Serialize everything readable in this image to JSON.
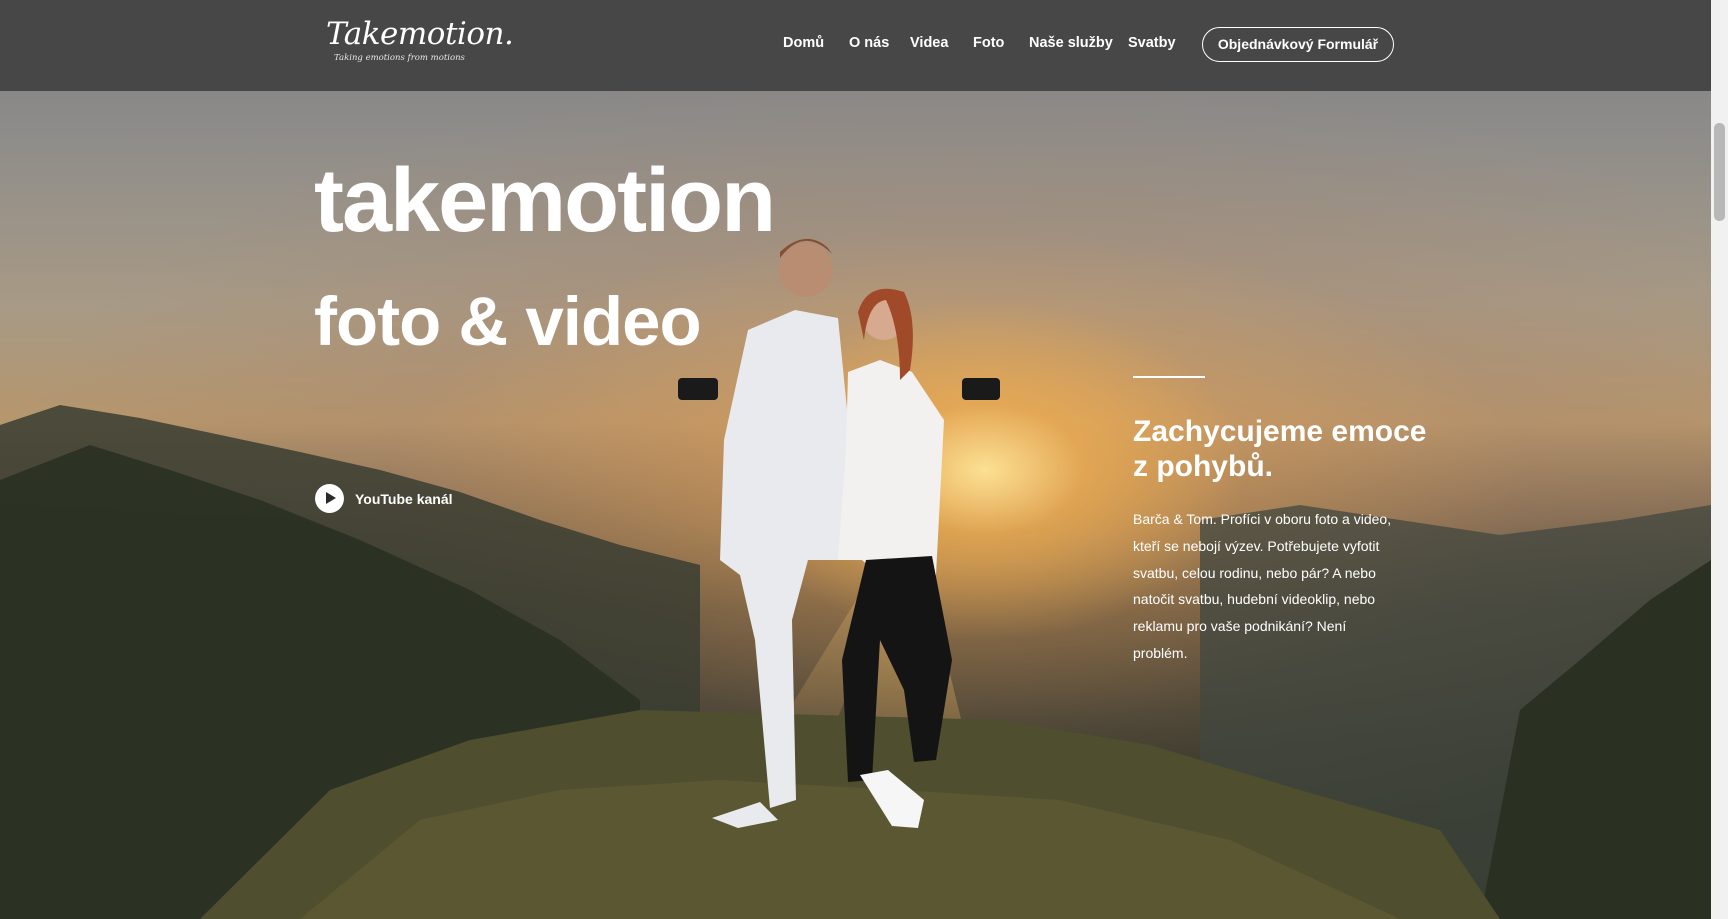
{
  "nav": {
    "logo_title": "Takemotion.",
    "logo_tagline": "Taking emotions from motions",
    "items": [
      "Domů",
      "O nás",
      "Videa",
      "Foto",
      "Naše služby",
      "Svatby"
    ],
    "cta_label": "Objednávkový Formulář"
  },
  "hero": {
    "title": "takemotion",
    "subtitle": "foto & video",
    "youtube_label": "YouTube kanál",
    "heading": "Zachycujeme emoce z pohybů.",
    "text": "Barča & Tom. Profíci v oboru foto a video, kteří se nebojí výzev. Potřebujete vyfotit svatbu, celou rodinu, nebo pár? A nebo natočit svatbu, hudební videoklip, nebo reklamu pro vaše podnikání? Není problém."
  },
  "colors": {
    "nav_background": "#474747",
    "text": "#ffffff",
    "sunset_accent": "#f2c27a"
  },
  "icons": {
    "play": "play-circle-icon"
  }
}
